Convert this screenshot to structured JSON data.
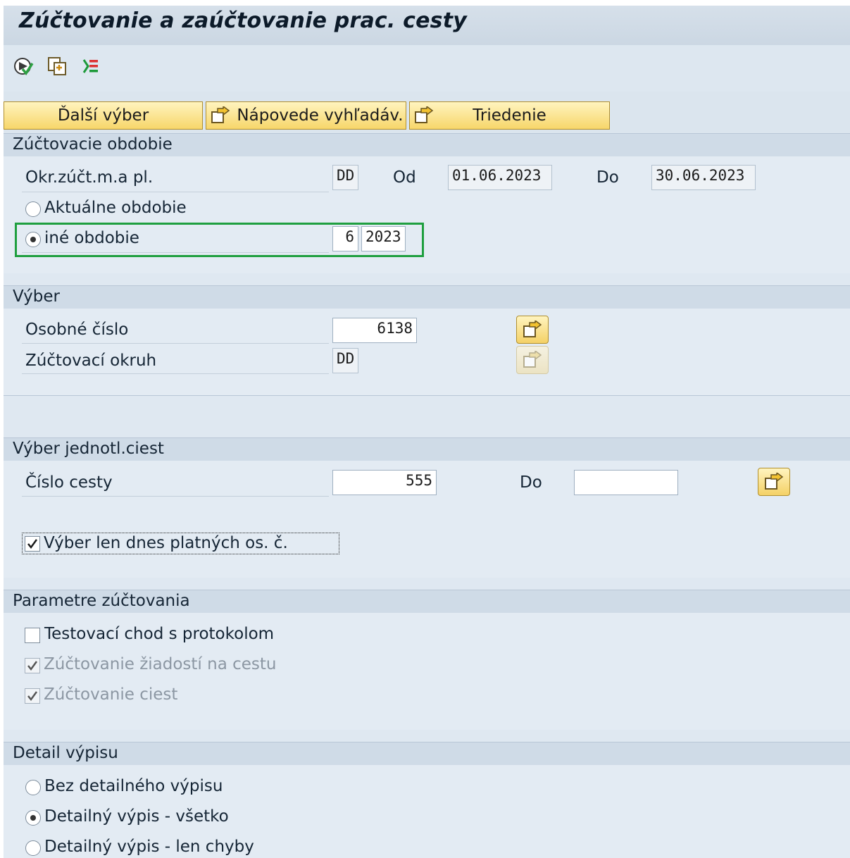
{
  "title": "Zúčtovanie a zaúčtovanie prac. cesty",
  "toolbar": {
    "icons": [
      "execute-icon",
      "copy-variant-icon",
      "selection-options-icon"
    ]
  },
  "buttons": {
    "dalsi_vyber": "Ďalší výber",
    "napovede": "Nápovede vyhľadáv.",
    "triedenie": "Triedenie"
  },
  "sections": {
    "obdobie": {
      "title": "Zúčtovacie obdobie",
      "okr_label": "Okr.zúčt.m.a pl.",
      "okr_value": "DD",
      "od_label": "Od",
      "od_value": "01.06.2023",
      "do_label": "Do",
      "do_value": "30.06.2023",
      "aktualne_label": "Aktuálne obdobie",
      "ine_label": "iné obdobie",
      "ine_month": "6",
      "ine_year": "2023",
      "selected": "ine"
    },
    "vyber": {
      "title": "Výber",
      "osobne_label": "Osobné číslo",
      "osobne_value": "6138",
      "okruh_label": "Zúčtovací okruh",
      "okruh_value": "DD"
    },
    "jednotl": {
      "title": "Výber jednotl.ciest",
      "cislo_label": "Číslo cesty",
      "cislo_value": "555",
      "do_label": "Do",
      "do_value": "",
      "checkbox_label": "Výber len dnes platných os. č.",
      "checked": true
    },
    "parametre": {
      "title": "Parametre zúčtovania",
      "test_label": "Testovací chod s protokolom",
      "test_checked": false,
      "ziadosti_label": "Zúčtovanie žiadostí na cestu",
      "ziadosti_checked": true,
      "ciest_label": "Zúčtovanie ciest",
      "ciest_checked": true
    },
    "detail": {
      "title": "Detail výpisu",
      "opt1": "Bez detailného výpisu",
      "opt2": "Detailný výpis - všetko",
      "opt3": "Detailný výpis - len chyby",
      "selected": "opt2"
    }
  },
  "colors": {
    "highlight_box": "#1f9f3f",
    "button_yellow": "#f7d66a"
  }
}
